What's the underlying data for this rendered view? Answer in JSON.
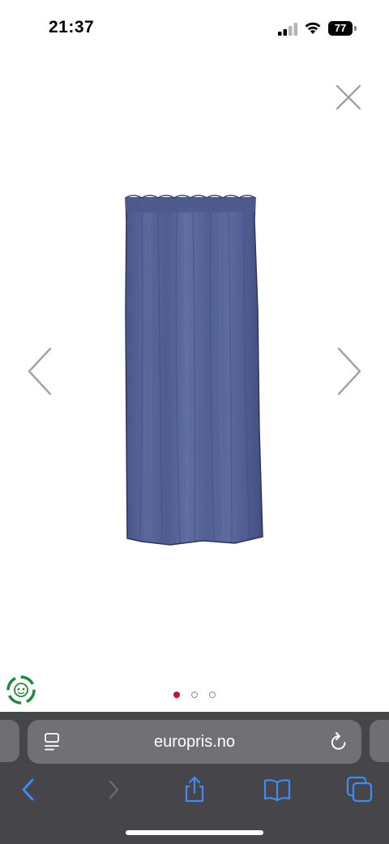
{
  "status_bar": {
    "time": "21:37",
    "battery_level": "77",
    "signal_icon": "cellular-signal-icon",
    "wifi_icon": "wifi-icon"
  },
  "gallery": {
    "close_icon": "close-icon",
    "prev_icon": "chevron-left-icon",
    "next_icon": "chevron-right-icon",
    "product_image": "navy-curtain-panel",
    "image_count": 3,
    "active_image_index": 0,
    "dot_active_color": "#c8102e",
    "eco_badge_icon": "recycle-badge-icon"
  },
  "browser": {
    "url": "europris.no",
    "reader_icon": "page-menu-icon",
    "reload_icon": "reload-icon",
    "toolbar": {
      "back_icon": "back-chevron-icon",
      "forward_icon": "forward-chevron-icon",
      "share_icon": "share-icon",
      "bookmarks_icon": "book-icon",
      "tabs_icon": "tabs-icon"
    },
    "accent_color": "#3d8bf8"
  }
}
